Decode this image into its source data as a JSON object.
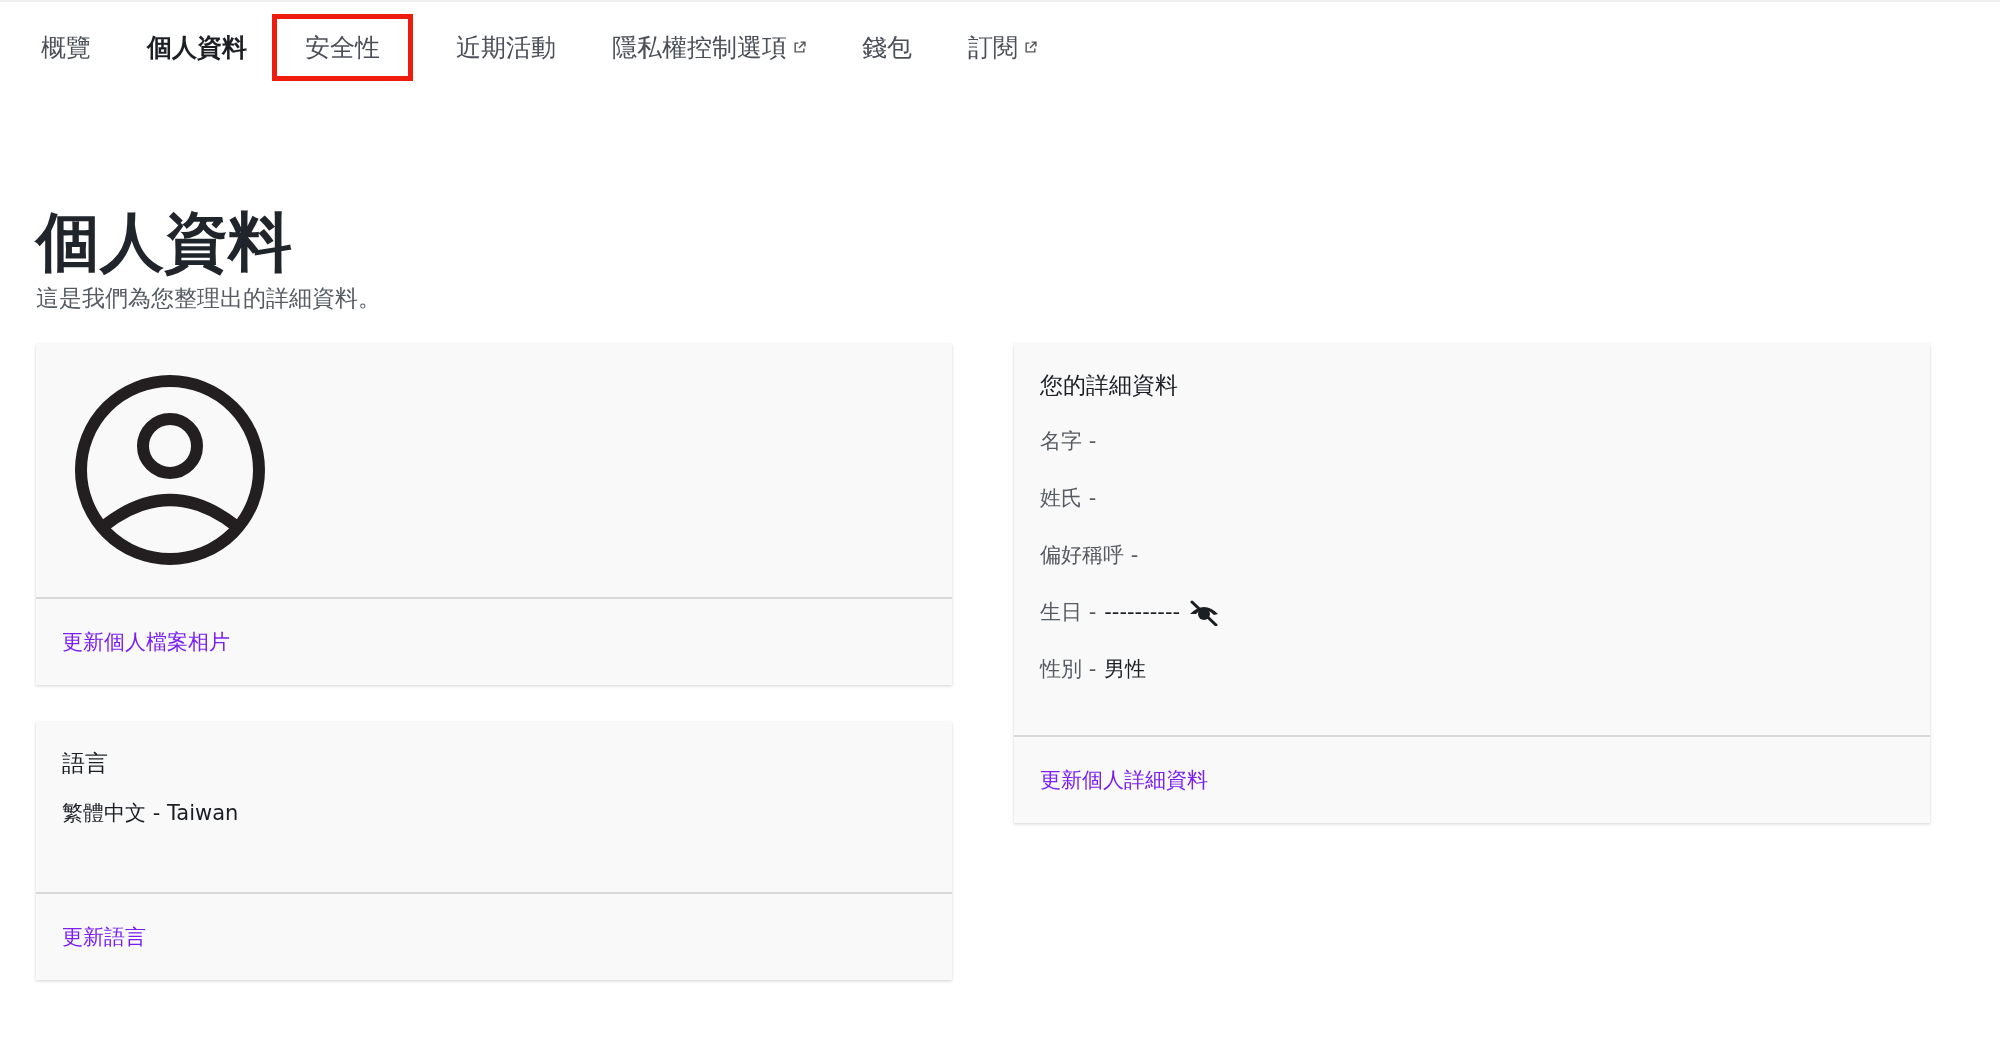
{
  "tabs": [
    {
      "label": "概覽",
      "selected": false,
      "external": false,
      "highlighted": false
    },
    {
      "label": "個人資料",
      "selected": true,
      "external": false,
      "highlighted": false
    },
    {
      "label": "安全性",
      "selected": false,
      "external": false,
      "highlighted": true
    },
    {
      "label": "近期活動",
      "selected": false,
      "external": false,
      "highlighted": false
    },
    {
      "label": "隱私權控制選項",
      "selected": false,
      "external": true,
      "highlighted": false
    },
    {
      "label": "錢包",
      "selected": false,
      "external": false,
      "highlighted": false
    },
    {
      "label": "訂閱",
      "selected": false,
      "external": true,
      "highlighted": false
    }
  ],
  "page": {
    "title": "個人資料",
    "subtitle": "這是我們為您整理出的詳細資料。"
  },
  "photo_card": {
    "link": "更新個人檔案相片"
  },
  "language_card": {
    "title": "語言",
    "value": "繁體中文 - Taiwan",
    "link": "更新語言"
  },
  "details_card": {
    "title": "您的詳細資料",
    "fields": [
      {
        "label": "名字 -"
      },
      {
        "label": "姓氏 -"
      },
      {
        "label": "偏好稱呼 -"
      },
      {
        "label": "生日 -",
        "masked_value": "----------",
        "hidden": true
      },
      {
        "label": "性別 -",
        "value": "男性"
      }
    ],
    "link": "更新個人詳細資料"
  }
}
